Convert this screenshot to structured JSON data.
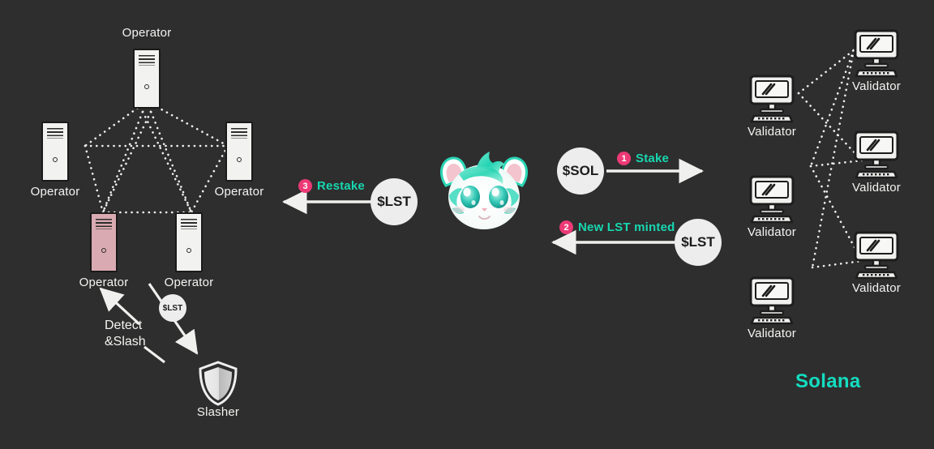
{
  "meta": {
    "background_color": "#2e2e2e",
    "accent_teal": "#17d7b0",
    "badge_pink": "#ec3a77",
    "node_white": "#f2f2f0",
    "node_pink": "#d9aab1"
  },
  "operators": [
    {
      "label": "Operator",
      "variant": "white"
    },
    {
      "label": "Operator",
      "variant": "white"
    },
    {
      "label": "Operator",
      "variant": "white"
    },
    {
      "label": "Operator",
      "variant": "pink"
    },
    {
      "label": "Operator",
      "variant": "white"
    }
  ],
  "validators": [
    {
      "label": "Validator"
    },
    {
      "label": "Validator"
    },
    {
      "label": "Validator"
    },
    {
      "label": "Validator"
    },
    {
      "label": "Validator"
    },
    {
      "label": "Validator"
    }
  ],
  "tokens": {
    "sol": "$SOL",
    "lst_minted": "$LST",
    "lst_restake": "$LST",
    "lst_slash": "$LST"
  },
  "steps": [
    {
      "number": "1",
      "label": "Stake"
    },
    {
      "number": "2",
      "label": "New LST minted"
    },
    {
      "number": "3",
      "label": "Restake"
    }
  ],
  "slasher": {
    "label": "Slasher",
    "action_line1": "Detect",
    "action_line2": "&Slash"
  },
  "network": {
    "label": "Solana"
  },
  "mascot": {
    "name": "cat-mascot"
  }
}
